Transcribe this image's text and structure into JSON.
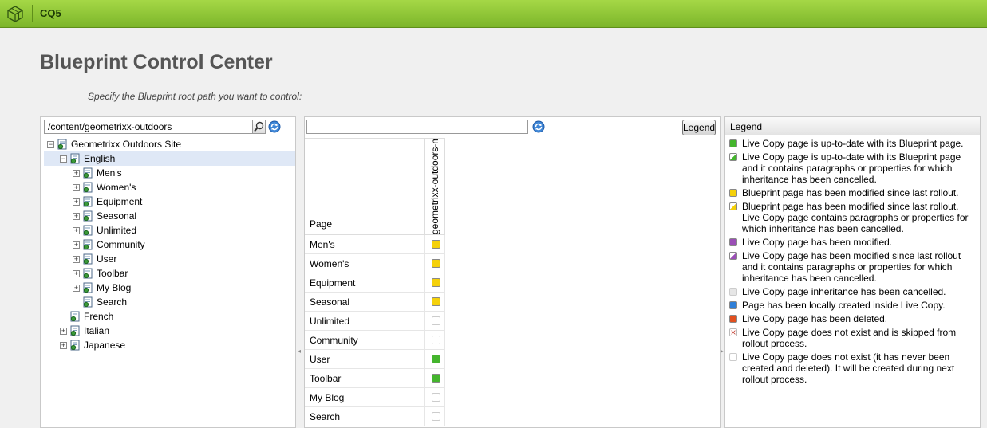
{
  "app": {
    "brand": "CQ5"
  },
  "page": {
    "title": "Blueprint Control Center",
    "subtitle": "Specify the Blueprint root path you want to control:"
  },
  "left": {
    "path_value": "/content/geometrixx-outdoors",
    "tree": [
      {
        "label": "Geometrixx Outdoors Site",
        "level": 0,
        "toggle": "minus"
      },
      {
        "label": "English",
        "level": 1,
        "toggle": "minus",
        "selected": true
      },
      {
        "label": "Men's",
        "level": 2,
        "toggle": "plus"
      },
      {
        "label": "Women's",
        "level": 2,
        "toggle": "plus"
      },
      {
        "label": "Equipment",
        "level": 2,
        "toggle": "plus"
      },
      {
        "label": "Seasonal",
        "level": 2,
        "toggle": "plus"
      },
      {
        "label": "Unlimited",
        "level": 2,
        "toggle": "plus"
      },
      {
        "label": "Community",
        "level": 2,
        "toggle": "plus"
      },
      {
        "label": "User",
        "level": 2,
        "toggle": "plus"
      },
      {
        "label": "Toolbar",
        "level": 2,
        "toggle": "plus"
      },
      {
        "label": "My Blog",
        "level": 2,
        "toggle": "plus"
      },
      {
        "label": "Search",
        "level": 2,
        "toggle": "none"
      },
      {
        "label": "French",
        "level": 1,
        "toggle": "none"
      },
      {
        "label": "Italian",
        "level": 1,
        "toggle": "plus"
      },
      {
        "label": "Japanese",
        "level": 1,
        "toggle": "plus"
      }
    ]
  },
  "middle": {
    "filter_value": "",
    "legend_button": "Legend",
    "page_header": "Page",
    "column_header": "geometrixx-outdoors-mobile",
    "rows": [
      {
        "page": "Men's",
        "status": "yellow"
      },
      {
        "page": "Women's",
        "status": "yellow"
      },
      {
        "page": "Equipment",
        "status": "yellow"
      },
      {
        "page": "Seasonal",
        "status": "yellow"
      },
      {
        "page": "Unlimited",
        "status": "empty"
      },
      {
        "page": "Community",
        "status": "empty"
      },
      {
        "page": "User",
        "status": "green"
      },
      {
        "page": "Toolbar",
        "status": "green"
      },
      {
        "page": "My Blog",
        "status": "empty"
      },
      {
        "page": "Search",
        "status": "empty"
      }
    ]
  },
  "legend": {
    "title": "Legend",
    "items": [
      {
        "icon": "green",
        "text": "Live Copy page is up-to-date with its Blueprint page."
      },
      {
        "icon": "green-partial",
        "text": "Live Copy page is up-to-date with its Blueprint page and it contains paragraphs or properties for which inheritance has been cancelled."
      },
      {
        "icon": "yellow",
        "text": "Blueprint page has been modified since last rollout."
      },
      {
        "icon": "yellow-partial",
        "text": "Blueprint page has been modified since last rollout. Live Copy page contains paragraphs or properties for which inheritance has been cancelled."
      },
      {
        "icon": "purple",
        "text": "Live Copy page has been modified."
      },
      {
        "icon": "purple-partial",
        "text": "Live Copy page has been modified since last rollout and it contains paragraphs or properties for which inheritance has been cancelled."
      },
      {
        "icon": "light-gray",
        "text": "Live Copy page inheritance has been cancelled."
      },
      {
        "icon": "blue",
        "text": "Page has been locally created inside Live Copy."
      },
      {
        "icon": "red",
        "text": "Live Copy page has been deleted."
      },
      {
        "icon": "cross",
        "text": "Live Copy page does not exist and is skipped from rollout process."
      },
      {
        "icon": "empty",
        "text": "Live Copy page does not exist (it has never been created and deleted). It will be created during next rollout process."
      }
    ]
  },
  "colors": {
    "green": "#44b52d",
    "yellow": "#f5d10a",
    "purple": "#9b4fb6",
    "blue": "#2f7fd8",
    "red": "#e2501f",
    "light-gray": "#e6e6e6",
    "empty": "#ffffff"
  }
}
